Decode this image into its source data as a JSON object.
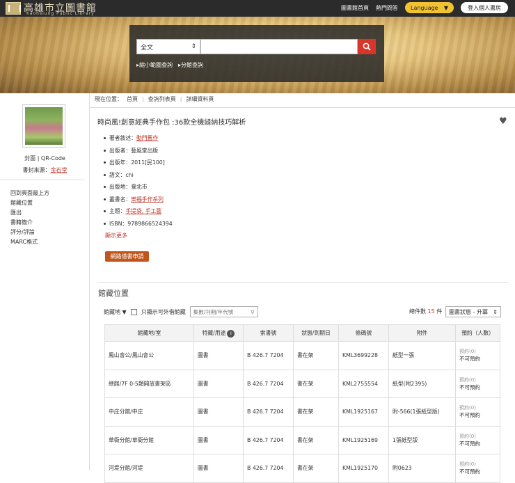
{
  "header": {
    "logo_title": "高雄市立圖書館",
    "logo_sub": "Kaohsiung Public Library",
    "links": [
      "圖書館首頁",
      "熱門問答"
    ],
    "language_label": "Language",
    "login_label": "登入個人書房"
  },
  "search": {
    "field_select": "全文",
    "query": "",
    "sub_links": [
      "縮小範圍查詢",
      "分館查詢"
    ]
  },
  "sidebar": {
    "cover_caption": "封面 | QR-Code",
    "cover_source_label": "書封來源：",
    "cover_source_link": "金石堂",
    "nav": [
      "回到頁面最上方",
      "館藏位置",
      "匯出",
      "書籍簡介",
      "評分/評論",
      "MARC格式"
    ]
  },
  "breadcrumb": [
    "現在位置：",
    "首頁",
    "查詢列表頁",
    "詳細資料頁"
  ],
  "record": {
    "title": "時尚風!創意經典手作包 :36款全機縫納技巧解析",
    "meta": [
      {
        "label": "著者敘述：",
        "value": "動門舊作",
        "link": true
      },
      {
        "label": "出版者：",
        "value": "藝風堂出版",
        "link": false
      },
      {
        "label": "出版年：",
        "value": "2011[民100]",
        "link": false
      },
      {
        "label": "語文：",
        "value": "chi",
        "link": false
      },
      {
        "label": "出版地：",
        "value": "臺北市",
        "link": false
      },
      {
        "label": "叢書名：",
        "value": "樂福手作系列",
        "link": true
      },
      {
        "label": "主題：",
        "value": "手提袋, 手工藝",
        "link": true
      },
      {
        "label": "ISBN：",
        "value": "9789866524394",
        "link": false
      }
    ],
    "show_more": "顯示更多",
    "ill_button": "網路借書申請"
  },
  "holdings": {
    "title": "館藏位置",
    "filter_label": "館藏地",
    "checkbox_label": "只顯示可外借館藏",
    "volume_placeholder": "集數/刊期/年代號",
    "count_prefix": "總件數",
    "count": "15",
    "count_suffix": "件",
    "sort_label": "圖書狀態 - 升冪",
    "columns": [
      "館藏地/室",
      "特藏/用途",
      "索書號",
      "狀態/到期日",
      "條碼號",
      "附件",
      "預約（人數）"
    ],
    "rows": [
      {
        "location": "鳳山會公/鳳山會公",
        "usage": "圖書",
        "callno": "B 426.7 7204",
        "status": "書在架",
        "barcode": "KML3699228",
        "attach": "紙型一張",
        "reserve_count": "預約(0)",
        "reserve_status": "不可預約"
      },
      {
        "location": "總館/7F 0-5類開放書架區",
        "usage": "圖書",
        "callno": "B 426.7 7204",
        "status": "書在架",
        "barcode": "KML2755554",
        "attach": "紙型(附2395)",
        "reserve_count": "預約(0)",
        "reserve_status": "不可預約"
      },
      {
        "location": "中庄分館/中庄",
        "usage": "圖書",
        "callno": "B 426.7 7204",
        "status": "書在架",
        "barcode": "KML1925167",
        "attach": "附-566(1張紙型版)",
        "reserve_count": "預約(0)",
        "reserve_status": "不可預約"
      },
      {
        "location": "草衙分館/草衙分館",
        "usage": "圖書",
        "callno": "B 426.7 7204",
        "status": "書在架",
        "barcode": "KML1925169",
        "attach": "1張紙型版",
        "reserve_count": "預約(0)",
        "reserve_status": "不可預約"
      },
      {
        "location": "河堤分館/河堤",
        "usage": "圖書",
        "callno": "B 426.7 7204",
        "status": "書在架",
        "barcode": "KML1925170",
        "attach": "附0623",
        "reserve_count": "預約(0)",
        "reserve_status": "不可預約"
      }
    ]
  }
}
